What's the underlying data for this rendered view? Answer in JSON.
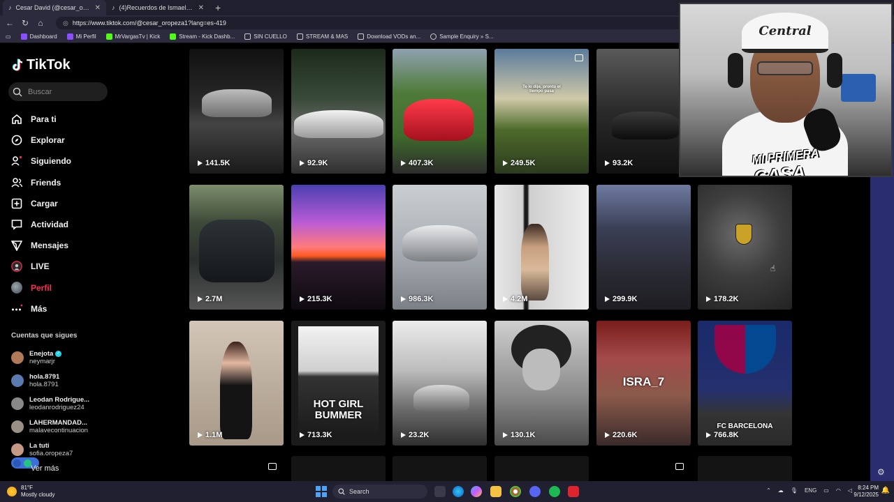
{
  "browser": {
    "tabs": [
      {
        "title": "Cesar David (@cesar_oropeza1) |",
        "active": true
      },
      {
        "title": "(4)Recuerdos de Ismael Casillas y",
        "active": false
      }
    ],
    "url": "https://www.tiktok.com/@cesar_oropeza1?lang=es-419",
    "bookmarks": [
      "Dashboard",
      "Mi Perfil",
      "MrVargasTv | Kick",
      "Stream - Kick Dashb...",
      "SIN CUELLO",
      "STREAM & MAS",
      "Download VODs an...",
      "Sample Enquiry » S..."
    ]
  },
  "sidebar": {
    "logo": "TikTok",
    "search_placeholder": "Buscar",
    "nav": [
      {
        "label": "Para ti",
        "icon": "home-icon"
      },
      {
        "label": "Explorar",
        "icon": "compass-icon"
      },
      {
        "label": "Siguiendo",
        "icon": "following-icon"
      },
      {
        "label": "Friends",
        "icon": "friends-icon"
      },
      {
        "label": "Cargar",
        "icon": "upload-icon"
      },
      {
        "label": "Actividad",
        "icon": "activity-icon"
      },
      {
        "label": "Mensajes",
        "icon": "messages-icon"
      },
      {
        "label": "LIVE",
        "icon": "live-icon"
      },
      {
        "label": "Perfil",
        "icon": "profile-avatar",
        "active": true
      },
      {
        "label": "Más",
        "icon": "more-icon"
      }
    ],
    "following_title": "Cuentas que sigues",
    "following": [
      {
        "name": "Enejota",
        "user": "neymarjr",
        "verified": true,
        "color": "#b07a5a"
      },
      {
        "name": "hola.8791",
        "user": "hola.8791",
        "verified": false,
        "color": "#5a7ab0"
      },
      {
        "name": "Leodan Rodrigue...",
        "user": "leodanrodriguez24",
        "verified": false,
        "color": "#888888"
      },
      {
        "name": "LAHERMANDAD...",
        "user": "malavecontinuacion",
        "verified": false,
        "color": "#9a8f86"
      },
      {
        "name": "La tuti",
        "user": "sofia.oropeza7",
        "verified": false,
        "color": "#c49a86"
      }
    ],
    "see_more": "Ver más"
  },
  "videos": [
    {
      "views": "141.5K"
    },
    {
      "views": "92.9K"
    },
    {
      "views": "407.3K"
    },
    {
      "views": "249.5K",
      "overlay": "Te lo dije, pronto el tiempo pasa"
    },
    {
      "views": "93.2K"
    },
    {
      "views": "2.7M"
    },
    {
      "views": "215.3K"
    },
    {
      "views": "986.3K"
    },
    {
      "views": "4.2M"
    },
    {
      "views": "299.9K"
    },
    {
      "views": "178.2K"
    },
    {
      "views": "1.1M"
    },
    {
      "views": "713.3K",
      "overlay": "HOT GIRL BUMMER"
    },
    {
      "views": "23.2K"
    },
    {
      "views": "130.1K"
    },
    {
      "views": "220.6K",
      "overlay": "ISRA_7"
    },
    {
      "views": "766.8K",
      "overlay": "FC BARCELONA"
    }
  ],
  "webcam": {
    "caption_line1": "MI PRIMERA",
    "caption_line2": "CASA",
    "cap_text": "Central"
  },
  "taskbar": {
    "temp": "81°F",
    "weather": "Mostly cloudy",
    "search_label": "Search",
    "lang": "ENG",
    "time": "8:24 PM",
    "date": "9/12/2025"
  }
}
